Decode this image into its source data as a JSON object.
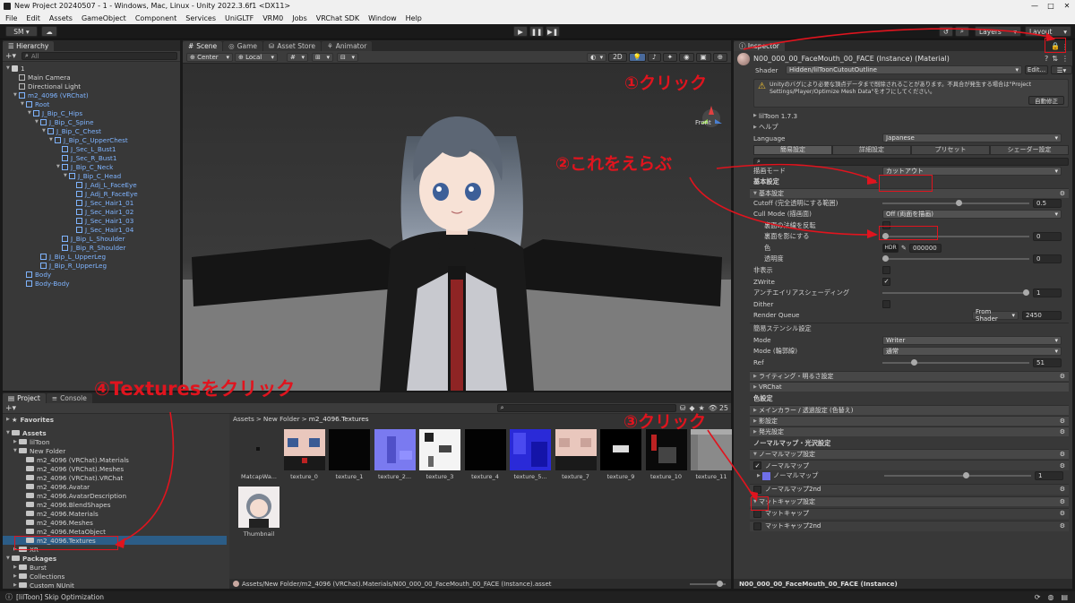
{
  "window": {
    "title": "New Project 20240507 - 1 - Windows, Mac, Linux - Unity 2022.3.6f1 <DX11>"
  },
  "menu": [
    "File",
    "Edit",
    "Assets",
    "GameObject",
    "Component",
    "Services",
    "UniGLTF",
    "VRM0",
    "Jobs",
    "VRChat SDK",
    "Window",
    "Help"
  ],
  "toolbar": {
    "account": "SM",
    "layers": "Layers",
    "layout": "Layout"
  },
  "hierarchy": {
    "tab": "Hierarchy",
    "search_placeholder": "All",
    "scene": "1",
    "items": [
      {
        "label": "Main Camera",
        "depth": 1,
        "blue": false
      },
      {
        "label": "Directional Light",
        "depth": 1,
        "blue": false
      },
      {
        "label": "m2_4096 (VRChat)",
        "depth": 1,
        "blue": true
      },
      {
        "label": "Root",
        "depth": 2,
        "blue": true
      },
      {
        "label": "J_Bip_C_Hips",
        "depth": 3,
        "blue": true
      },
      {
        "label": "J_Bip_C_Spine",
        "depth": 4,
        "blue": true
      },
      {
        "label": "J_Bip_C_Chest",
        "depth": 5,
        "blue": true
      },
      {
        "label": "J_Bip_C_UpperChest",
        "depth": 6,
        "blue": true
      },
      {
        "label": "J_Sec_L_Bust1",
        "depth": 7,
        "blue": true
      },
      {
        "label": "J_Sec_R_Bust1",
        "depth": 7,
        "blue": true
      },
      {
        "label": "J_Bip_C_Neck",
        "depth": 7,
        "blue": true
      },
      {
        "label": "J_Bip_C_Head",
        "depth": 8,
        "blue": true
      },
      {
        "label": "J_Adj_L_FaceEye",
        "depth": 9,
        "blue": true
      },
      {
        "label": "J_Adj_R_FaceEye",
        "depth": 9,
        "blue": true
      },
      {
        "label": "J_Sec_Hair1_01",
        "depth": 9,
        "blue": true
      },
      {
        "label": "J_Sec_Hair1_02",
        "depth": 9,
        "blue": true
      },
      {
        "label": "J_Sec_Hair1_03",
        "depth": 9,
        "blue": true
      },
      {
        "label": "J_Sec_Hair1_04",
        "depth": 9,
        "blue": true
      },
      {
        "label": "J_Bip_L_Shoulder",
        "depth": 7,
        "blue": true
      },
      {
        "label": "J_Bip_R_Shoulder",
        "depth": 7,
        "blue": true
      },
      {
        "label": "J_Bip_L_UpperLeg",
        "depth": 4,
        "blue": true
      },
      {
        "label": "J_Bip_R_UpperLeg",
        "depth": 4,
        "blue": true
      },
      {
        "label": "Body",
        "depth": 2,
        "blue": true
      },
      {
        "label": "Body-Body",
        "depth": 2,
        "blue": true
      }
    ]
  },
  "scene_tabs": [
    "Scene",
    "Game",
    "Asset Store",
    "Animator"
  ],
  "scene_toolbar": {
    "pivot": "Center",
    "space": "Local",
    "mode2d": "2D"
  },
  "gizmo_label": "Front",
  "project": {
    "tabs": [
      "Project",
      "Console"
    ],
    "count": "25",
    "favorites": "Favorites",
    "tree": [
      {
        "label": "Assets",
        "depth": 0,
        "bold": true
      },
      {
        "label": "lilToon",
        "depth": 1,
        "bold": false
      },
      {
        "label": "New Folder",
        "depth": 1,
        "bold": false
      },
      {
        "label": "m2_4096 (VRChat).Materials",
        "depth": 2,
        "bold": false
      },
      {
        "label": "m2_4096 (VRChat).Meshes",
        "depth": 2,
        "bold": false
      },
      {
        "label": "m2_4096 (VRChat).VRChat",
        "depth": 2,
        "bold": false
      },
      {
        "label": "m2_4096.Avatar",
        "depth": 2,
        "bold": false
      },
      {
        "label": "m2_4096.AvatarDescription",
        "depth": 2,
        "bold": false
      },
      {
        "label": "m2_4096.BlendShapes",
        "depth": 2,
        "bold": false
      },
      {
        "label": "m2_4096.Materials",
        "depth": 2,
        "bold": false
      },
      {
        "label": "m2_4096.Meshes",
        "depth": 2,
        "bold": false
      },
      {
        "label": "m2_4096.MetaObject",
        "depth": 2,
        "bold": false
      },
      {
        "label": "m2_4096.Textures",
        "depth": 2,
        "bold": false
      },
      {
        "label": "XR",
        "depth": 1,
        "bold": false
      },
      {
        "label": "Packages",
        "depth": 0,
        "bold": true
      },
      {
        "label": "Burst",
        "depth": 1,
        "bold": false
      },
      {
        "label": "Collections",
        "depth": 1,
        "bold": false
      },
      {
        "label": "Custom NUnit",
        "depth": 1,
        "bold": false
      }
    ],
    "breadcrumb": [
      "Assets",
      "New Folder",
      "m2_4096.Textures"
    ],
    "assets": [
      "MatcapWa...",
      "texture_0",
      "texture_1",
      "texture_2...",
      "texture_3",
      "texture_4",
      "texture_5...",
      "texture_7",
      "texture_9",
      "texture_10",
      "texture_11",
      "Thumbnail"
    ],
    "path": "Assets/New Folder/m2_4096 (VRChat).Materials/N00_000_00_FaceMouth_00_FACE (Instance).asset"
  },
  "inspector": {
    "tab": "Inspector",
    "material_name": "N00_000_00_FaceMouth_00_FACE (Instance) (Material)",
    "shader_label": "Shader",
    "shader_value": "Hidden/lilToonCutoutOutline",
    "edit_button": "Edit...",
    "warning": "Unityのバグにより必要な頂点データまで削除されることがあります。不具合が発生する場合は\"Project Settings/Player/Optimize Mesh Data\"をオフにしてください。",
    "auto_fix": "自動修正",
    "version": "lilToon 1.7.3",
    "help": "ヘルプ",
    "language_label": "Language",
    "language_value": "Japanese",
    "tabs": [
      "簡易設定",
      "詳細設定",
      "プリセット",
      "シェーダー設定"
    ],
    "render_mode_label": "描画モード",
    "render_mode_value": "カットアウト",
    "basic_header": "基本設定",
    "basic_foldout": "基本設定",
    "cutoff_label": "Cutoff (完全透明にする範囲)",
    "cutoff_value": "0.5",
    "cull_label": "Cull Mode (描画面)",
    "cull_value": "Off (両面を描画)",
    "backface_normal": "裏面の法線を反転",
    "backface_shadow": "裏面を影にする",
    "backface_shadow_value": "0",
    "color_label": "色",
    "hdr": "HDR",
    "color_value": "000000",
    "transparency_label": "透明度",
    "transparency_value": "0",
    "hide_label": "非表示",
    "zwrite_label": "ZWrite",
    "aa_label": "アンチエイリアスシェーディング",
    "aa_value": "1",
    "dither_label": "Dither",
    "render_queue_label": "Render Queue",
    "render_queue_source": "From Shader",
    "render_queue_value": "2450",
    "stencil_header": "簡易ステンシル設定",
    "mode_label": "Mode",
    "mode_value": "Writer",
    "mode_outline_label": "Mode (輪郭線)",
    "mode_outline_value": "通常",
    "ref_label": "Ref",
    "ref_value": "51",
    "lighting": "ライティング・明るさ設定",
    "vrchat": "VRChat",
    "color_header": "色設定",
    "main_color": "メインカラー / 透過設定 (色替え)",
    "shadow": "影設定",
    "emission": "発光設定",
    "normal_header": "ノーマルマップ・光沢設定",
    "normal_foldout": "ノーマルマップ設定",
    "normal_map": "ノーマルマップ",
    "normal_map_sub": "ノーマルマップ",
    "normal_map_value": "1",
    "normal_map_2nd": "ノーマルマップ2nd",
    "matcap_foldout": "マットキャップ設定",
    "matcap": "マットキャップ",
    "matcap_2nd": "マットキャップ2nd",
    "footer": "N00_000_00_FaceMouth_00_FACE (Instance)"
  },
  "status_bar": "[lilToon] Skip Optimization",
  "annotations": {
    "a1": "①クリック",
    "a2": "②これをえらぶ",
    "a3": "③クリック",
    "a4": "④Texturesをクリック"
  }
}
